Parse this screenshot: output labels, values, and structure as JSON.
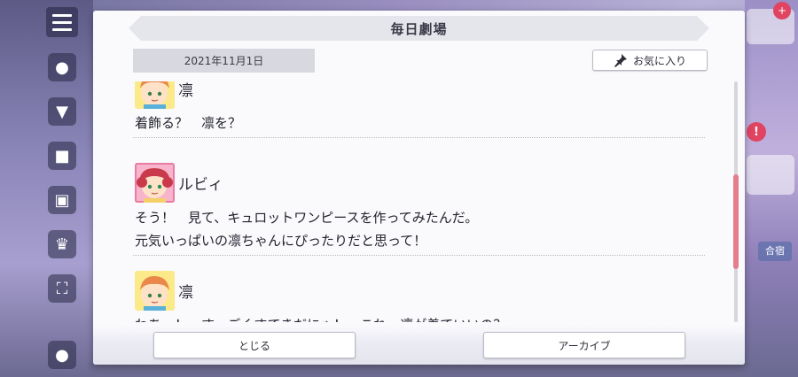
{
  "dialog": {
    "title": "毎日劇場",
    "date": "2021年11月1日",
    "favorite_label": "お気に入り",
    "close_label": "とじる",
    "archive_label": "アーカイブ"
  },
  "entries": [
    {
      "speaker": "凛",
      "lines": [
        "着飾る？　凛を？"
      ]
    },
    {
      "speaker": "ルビィ",
      "lines": [
        "そう！　見て、キュロットワンピースを作ってみたんだ。",
        "元気いっぱいの凛ちゃんにぴったりだと思って！"
      ]
    },
    {
      "speaker": "凛",
      "lines": [
        "わあ～！　すっごくすてきだにゃ！　これ、凛が着ていいの？"
      ]
    }
  ],
  "background": {
    "side_label": "合宿"
  },
  "colors": {
    "accent_scroll": "#e47e8e",
    "badge_red": "#e04461",
    "rin_avatar_bg": "#fbe98a",
    "ruby_avatar_bg": "#f7b4cc"
  }
}
